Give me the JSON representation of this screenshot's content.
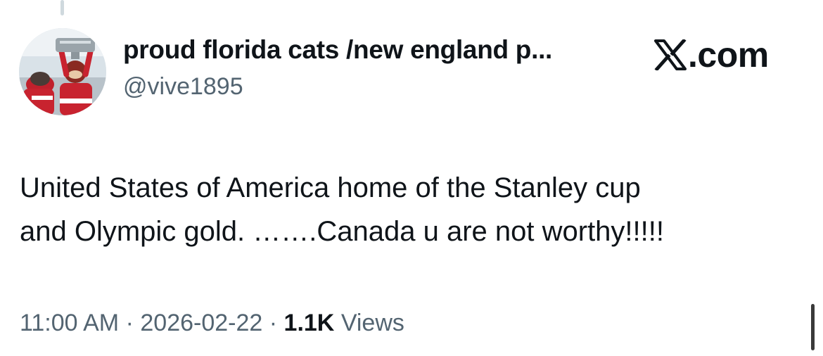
{
  "author": {
    "display_name": "proud florida cats /new england p...",
    "handle": "@vive1895",
    "avatar_icon": "profile-photo-mascot-with-cup"
  },
  "site_badge": {
    "icon": "x-logo-icon",
    "text": ".com"
  },
  "tweet": {
    "text_lines": [
      "United States of America home of the Stanley cup",
      "and Olympic gold. …….Canada u are not worthy!!!!!"
    ]
  },
  "meta": {
    "time": "11:00 AM",
    "separator": "·",
    "date": "2026-02-22",
    "views_count": "1.1K",
    "views_label": "Views"
  },
  "colors": {
    "text_primary": "#0f1419",
    "text_secondary": "#536471",
    "thread_line": "#cfd9de"
  }
}
